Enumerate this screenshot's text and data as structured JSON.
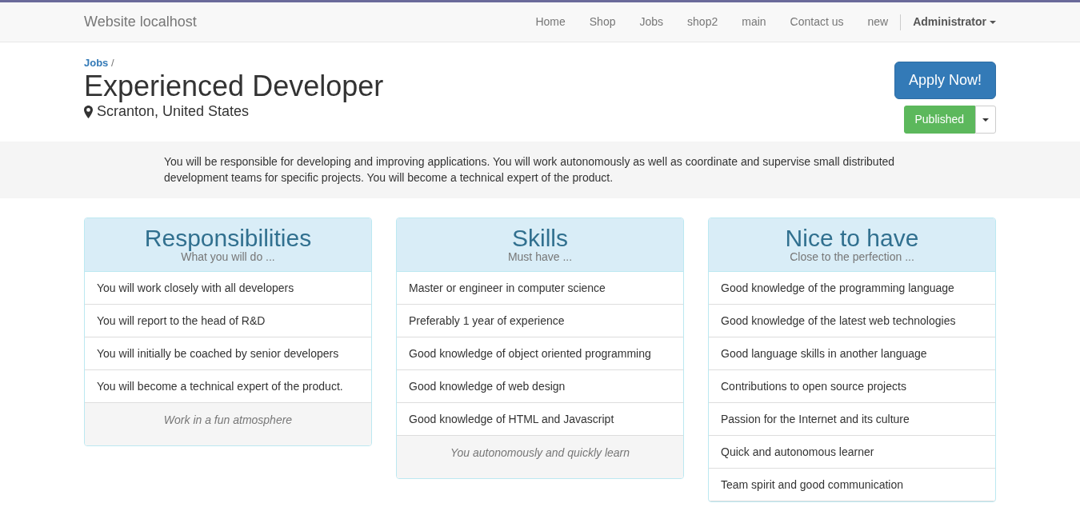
{
  "navbar": {
    "brand": "Website localhost",
    "links": [
      {
        "label": "Home"
      },
      {
        "label": "Shop"
      },
      {
        "label": "Jobs"
      },
      {
        "label": "shop2"
      },
      {
        "label": "main"
      },
      {
        "label": "Contact us"
      },
      {
        "label": "new"
      }
    ],
    "user": "Administrator"
  },
  "header": {
    "breadcrumb": {
      "link": "Jobs",
      "separator": "/"
    },
    "title": "Experienced Developer",
    "location": "Scranton, United States",
    "apply_button": "Apply Now!",
    "status_button": "Published"
  },
  "intro": "You will be responsible for developing and improving applications. You will work autonomously as well as coordinate and supervise small distributed development teams for specific projects. You will become a technical expert of the product.",
  "panels": [
    {
      "title": "Responsibilities",
      "subtitle": "What you will do ...",
      "items": [
        "You will work closely with all developers",
        "You will report to the head of R&D",
        "You will initially be coached by senior developers",
        "You will become a technical expert of the product."
      ],
      "footer": "Work in a fun atmosphere"
    },
    {
      "title": "Skills",
      "subtitle": "Must have ...",
      "items": [
        "Master or engineer in computer science",
        "Preferably 1 year of experience",
        "Good knowledge of object oriented programming",
        "Good knowledge of web design",
        "Good knowledge of HTML and Javascript"
      ],
      "footer": "You autonomously and quickly learn"
    },
    {
      "title": "Nice to have",
      "subtitle": "Close to the perfection ...",
      "items": [
        "Good knowledge of the programming language",
        "Good knowledge of the latest web technologies",
        "Good language skills in another language",
        "Contributions to open source projects",
        "Passion for the Internet and its culture",
        "Quick and autonomous learner",
        "Team spirit and good communication"
      ]
    }
  ]
}
